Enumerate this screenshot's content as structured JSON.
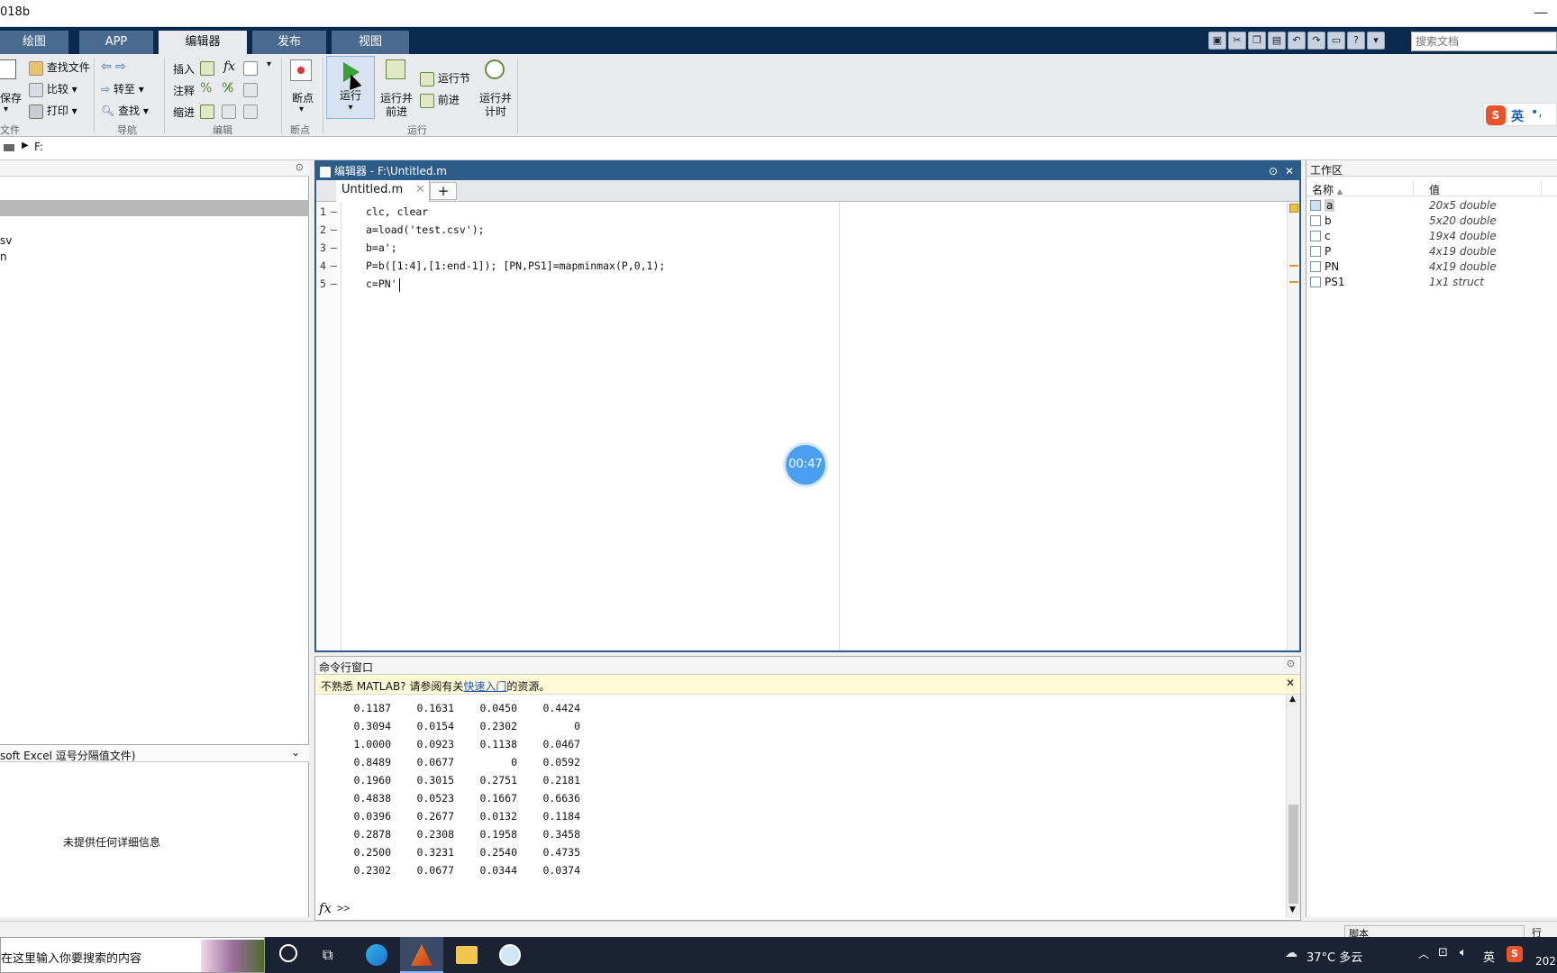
{
  "window": {
    "title": "018b"
  },
  "ribbon_tabs": [
    {
      "label": "绘图"
    },
    {
      "label": "APP"
    },
    {
      "label": "编辑器"
    },
    {
      "label": "发布"
    },
    {
      "label": "视图"
    }
  ],
  "search": {
    "placeholder": "搜索文档"
  },
  "ribbon": {
    "file": {
      "save": "保存",
      "find_files": "查找文件",
      "compare": "比较",
      "print": "打印",
      "group": "文件"
    },
    "nav": {
      "goto": "转至",
      "find": "查找",
      "group": "导航"
    },
    "edit": {
      "insert": "插入",
      "comment": "注释",
      "indent": "缩进",
      "fx": "fx",
      "group": "编辑"
    },
    "breakpoints": {
      "label": "断点",
      "group": "断点"
    },
    "run": {
      "run": "运行",
      "run_advance_1": "运行并",
      "run_advance_2": "前进",
      "run_section": "运行节",
      "advance": "前进",
      "run_time_1": "运行并",
      "run_time_2": "计时",
      "group": "运行"
    }
  },
  "ime": {
    "label": "英"
  },
  "address": {
    "path": "F:"
  },
  "left_panel": {
    "items": [
      "sv",
      "n"
    ],
    "details_header": "soft Excel 逗号分隔值文件)",
    "no_details": "未提供任何详细信息"
  },
  "editor": {
    "header": "编辑器 - F:\\Untitled.m",
    "tab": "Untitled.m",
    "add_tab": "+",
    "lines": [
      {
        "no": "1",
        "dash": "–",
        "code": "clc, clear"
      },
      {
        "no": "2",
        "dash": "–",
        "code": "a=load('test.csv');"
      },
      {
        "no": "3",
        "dash": "–",
        "code": "b=a';"
      },
      {
        "no": "4",
        "dash": "–",
        "code": "P=b([1:4],[1:end-1]); [PN,PS1]=mapminmax(P,0,1);"
      },
      {
        "no": "5",
        "dash": "–",
        "code": "c=PN'"
      }
    ],
    "timer": "00:47"
  },
  "command_window": {
    "title": "命令行窗口",
    "notice_prefix": "不熟悉 MATLAB? 请参阅有关",
    "notice_link": "快速入门",
    "notice_suffix": "的资源。",
    "rows": [
      [
        "0.1187",
        "0.1631",
        "0.0450",
        "0.4424"
      ],
      [
        "0.3094",
        "0.0154",
        "0.2302",
        "0"
      ],
      [
        "1.0000",
        "0.0923",
        "0.1138",
        "0.0467"
      ],
      [
        "0.8489",
        "0.0677",
        "0",
        "0.0592"
      ],
      [
        "0.1960",
        "0.3015",
        "0.2751",
        "0.2181"
      ],
      [
        "0.4838",
        "0.0523",
        "0.1667",
        "0.6636"
      ],
      [
        "0.0396",
        "0.2677",
        "0.0132",
        "0.1184"
      ],
      [
        "0.2878",
        "0.2308",
        "0.1958",
        "0.3458"
      ],
      [
        "0.2500",
        "0.3231",
        "0.2540",
        "0.4735"
      ],
      [
        "0.2302",
        "0.0677",
        "0.0344",
        "0.0374"
      ]
    ],
    "fx": "fx",
    "prompt": ">>"
  },
  "workspace": {
    "title": "工作区",
    "col_name": "名称",
    "col_value": "值",
    "vars": [
      {
        "name": "a",
        "value": "20x5 double"
      },
      {
        "name": "b",
        "value": "5x20 double"
      },
      {
        "name": "c",
        "value": "19x4 double"
      },
      {
        "name": "P",
        "value": "4x19 double"
      },
      {
        "name": "PN",
        "value": "4x19 double"
      },
      {
        "name": "PS1",
        "value": "1x1 struct"
      }
    ]
  },
  "status": {
    "script": "脚本",
    "line": "行"
  },
  "taskbar": {
    "search": "在这里输入你要搜索的内容",
    "weather": "37°C 多云",
    "lang": "英",
    "year": "202"
  }
}
